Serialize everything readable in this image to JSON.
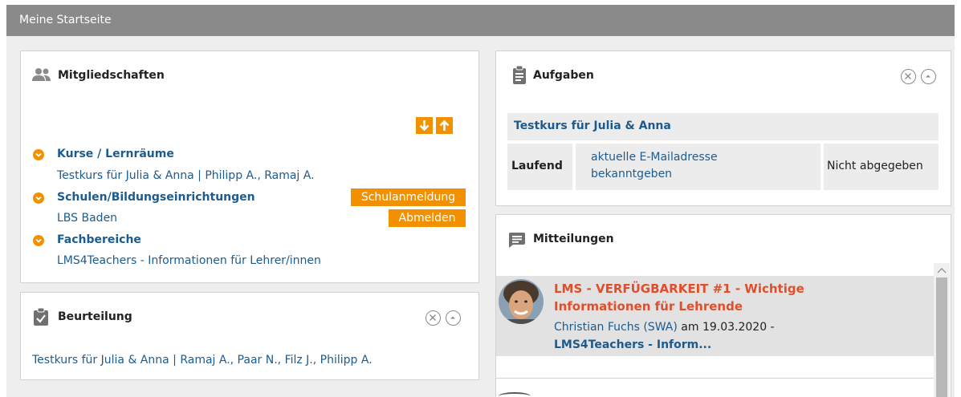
{
  "header": {
    "title": "Meine Startseite"
  },
  "memberships": {
    "title": "Mitgliedschaften",
    "icon": "group-icon",
    "sections": [
      {
        "title": "Kurse / Lernräume",
        "items": [
          "Testkurs für Julia & Anna | Philipp A., Ramaj A."
        ]
      },
      {
        "title": "Schulen/Bildungseinrichtungen",
        "items": [
          "LBS Baden"
        ]
      },
      {
        "title": "Fachbereiche",
        "items": [
          "LMS4Teachers - Informationen für Lehrer/innen"
        ]
      }
    ],
    "school_signup_label": "Schulanmeldung",
    "unsubscribe_label": "Abmelden"
  },
  "assessment": {
    "title": "Beurteilung",
    "icon": "clipboard-check-icon",
    "item": "Testkurs für Julia & Anna | Ramaj A., Paar N., Filz J., Philipp A."
  },
  "tasks": {
    "title": "Aufgaben",
    "icon": "clipboard-list-icon",
    "course": "Testkurs für Julia & Anna",
    "row": {
      "status": "Laufend",
      "task": "aktuelle E-Mailadresse bekanntgeben",
      "submission": "Nicht abgegeben"
    }
  },
  "messages": {
    "title": "Mitteilungen",
    "icon": "chat-icon",
    "items": [
      {
        "headline": "LMS - VERFÜGBARKEIT #1 - Wichtige Informationen für Lehrende",
        "author": "Christian Fuchs (SWA)",
        "date_prefix": "am",
        "date": "19.03.2020 -",
        "course": "LMS4Teachers - Inform..."
      }
    ]
  },
  "colors": {
    "accent": "#f29100",
    "link": "#1d5b8f",
    "header": "#8a8a8a",
    "alert": "#e04e2c"
  }
}
